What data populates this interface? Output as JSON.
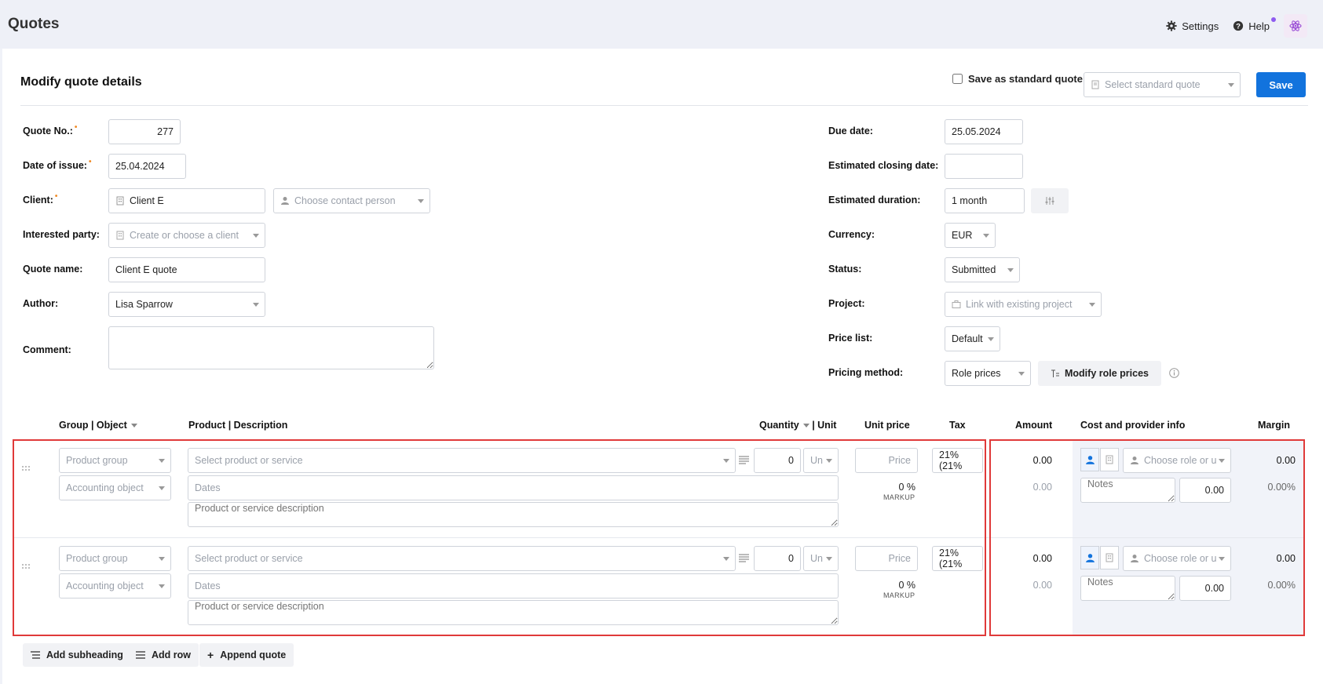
{
  "app": {
    "title": "Quotes",
    "settings_label": "Settings",
    "help_label": "Help"
  },
  "header": {
    "title": "Modify quote details",
    "save_standard_label": "Save as standard quote",
    "select_standard_placeholder": "Select standard quote",
    "save_label": "Save"
  },
  "left_fields": {
    "quote_no_label": "Quote No.:",
    "quote_no_value": "277",
    "date_issue_label": "Date of issue:",
    "date_issue_value": "25.04.2024",
    "client_label": "Client:",
    "client_value": "Client E",
    "contact_placeholder": "Choose contact person",
    "interested_label": "Interested party:",
    "interested_placeholder": "Create or choose a client",
    "quote_name_label": "Quote name:",
    "quote_name_value": "Client E quote",
    "author_label": "Author:",
    "author_value": "Lisa Sparrow",
    "comment_label": "Comment:"
  },
  "right_fields": {
    "due_label": "Due date:",
    "due_value": "25.05.2024",
    "closing_label": "Estimated closing date:",
    "closing_value": "",
    "duration_label": "Estimated duration:",
    "duration_value": "1 month",
    "currency_label": "Currency:",
    "currency_value": "EUR",
    "status_label": "Status:",
    "status_value": "Submitted",
    "project_label": "Project:",
    "project_placeholder": "Link with existing project",
    "pricelist_label": "Price list:",
    "pricelist_value": "Default",
    "pricing_label": "Pricing method:",
    "pricing_value": "Role prices",
    "modify_role_label": "Modify role prices"
  },
  "table": {
    "col_group": "Group | Object",
    "col_product": "Product | Description",
    "col_quantity": "Quantity",
    "col_unit": "| Unit",
    "col_unit_price": "Unit price",
    "col_tax": "Tax",
    "col_amount": "Amount",
    "col_cost": "Cost and provider info",
    "col_margin": "Margin",
    "rows": [
      {
        "group_placeholder": "Product group",
        "object_placeholder": "Accounting object",
        "product_placeholder": "Select product or service",
        "dates_placeholder": "Dates",
        "desc_placeholder": "Product or service description",
        "quantity": "0",
        "unit_placeholder": "Un",
        "price_placeholder": "Price",
        "markup": "0 %",
        "markup_label": "MARKUP",
        "tax": "21% (21%",
        "amount": "0.00",
        "amount_sub": "0.00",
        "role_placeholder": "Choose role or u",
        "notes_placeholder": "Notes",
        "cost": "0.00",
        "margin": "0.00",
        "margin_pct": "0.00%"
      },
      {
        "group_placeholder": "Product group",
        "object_placeholder": "Accounting object",
        "product_placeholder": "Select product or service",
        "dates_placeholder": "Dates",
        "desc_placeholder": "Product or service description",
        "quantity": "0",
        "unit_placeholder": "Un",
        "price_placeholder": "Price",
        "markup": "0 %",
        "markup_label": "MARKUP",
        "tax": "21% (21%",
        "amount": "0.00",
        "amount_sub": "0.00",
        "role_placeholder": "Choose role or u",
        "notes_placeholder": "Notes",
        "cost": "0.00",
        "margin": "0.00",
        "margin_pct": "0.00%"
      }
    ]
  },
  "footer": {
    "add_subheading": "Add subheading",
    "add_row": "Add row",
    "append_quote": "Append quote"
  },
  "colors": {
    "accent": "#1273dd",
    "highlight": "#e03a3a",
    "required": "#f08a24"
  },
  "icons": [
    "gear-icon",
    "help-icon",
    "atom-logo-icon",
    "building-icon",
    "person-icon",
    "briefcase-icon",
    "sliders-icon",
    "role-prices-icon",
    "info-icon",
    "lines-icon",
    "drag-handle-icon",
    "document-icon"
  ]
}
